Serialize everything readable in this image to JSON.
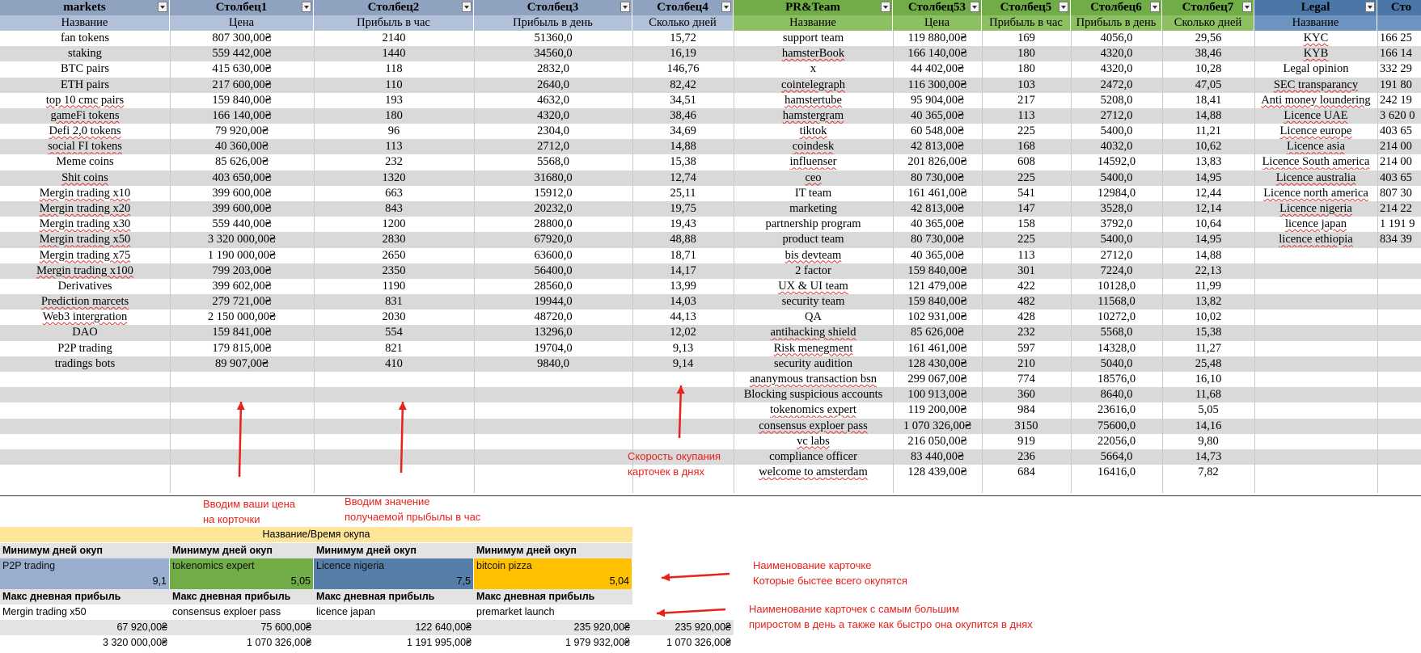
{
  "colors": {
    "header_blue": "#8fa3c1",
    "subheader_blue": "#b2c0d8",
    "header_green": "#70ad47",
    "subheader_green": "#8cc063",
    "header_steel": "#4a76a8",
    "subheader_steel": "#6d93bf",
    "stripe": "#d9d9d9",
    "yellow_band": "#fde59a",
    "summary_gray": "#e3e3e3",
    "steel_cell": "#557ea8",
    "gold_cell": "#ffc000",
    "annotation_red": "#e8211b"
  },
  "markets": {
    "headers": [
      "markets",
      "Столбец1",
      "Столбец2",
      "Столбец3",
      "Столбец4"
    ],
    "subheaders": [
      "Название",
      "Цена",
      "Прибыль в час",
      "Прибыль в день",
      "Сколько дней"
    ],
    "rows": [
      [
        "fan tokens",
        "807 300,00₴",
        "2140",
        "51360,0",
        "15,72"
      ],
      [
        "staking",
        "559 442,00₴",
        "1440",
        "34560,0",
        "16,19"
      ],
      [
        "BTC pairs",
        "415 630,00₴",
        "118",
        "2832,0",
        "146,76"
      ],
      [
        "ETH pairs",
        "217 600,00₴",
        "110",
        "2640,0",
        "82,42"
      ],
      [
        "top 10 cmc pairs",
        "159 840,00₴",
        "193",
        "4632,0",
        "34,51"
      ],
      [
        "gameFi tokens",
        "166 140,00₴",
        "180",
        "4320,0",
        "38,46"
      ],
      [
        "Defi 2,0 tokens",
        "79 920,00₴",
        "96",
        "2304,0",
        "34,69"
      ],
      [
        "social FI tokens",
        "40 360,00₴",
        "113",
        "2712,0",
        "14,88"
      ],
      [
        "Meme coins",
        "85 626,00₴",
        "232",
        "5568,0",
        "15,38"
      ],
      [
        "Shit coins",
        "403 650,00₴",
        "1320",
        "31680,0",
        "12,74"
      ],
      [
        "Mergin trading x10",
        "399 600,00₴",
        "663",
        "15912,0",
        "25,11"
      ],
      [
        "Mergin trading x20",
        "399 600,00₴",
        "843",
        "20232,0",
        "19,75"
      ],
      [
        "Mergin trading x30",
        "559 440,00₴",
        "1200",
        "28800,0",
        "19,43"
      ],
      [
        "Mergin trading x50",
        "3 320 000,00₴",
        "2830",
        "67920,0",
        "48,88"
      ],
      [
        "Mergin trading x75",
        "1 190 000,00₴",
        "2650",
        "63600,0",
        "18,71"
      ],
      [
        "Mergin trading x100",
        "799 203,00₴",
        "2350",
        "56400,0",
        "14,17"
      ],
      [
        "Derivatives",
        "399 602,00₴",
        "1190",
        "28560,0",
        "13,99"
      ],
      [
        "Prediction marcets",
        "279 721,00₴",
        "831",
        "19944,0",
        "14,03"
      ],
      [
        "Web3 intergration",
        "2 150 000,00₴",
        "2030",
        "48720,0",
        "44,13"
      ],
      [
        "DAO",
        "159 841,00₴",
        "554",
        "13296,0",
        "12,02"
      ],
      [
        "P2P trading",
        "179 815,00₴",
        "821",
        "19704,0",
        "9,13"
      ],
      [
        "tradings bots",
        "89 907,00₴",
        "410",
        "9840,0",
        "9,14"
      ]
    ]
  },
  "prteam": {
    "headers": [
      "PR&Team",
      "Столбец53",
      "Столбец5",
      "Столбец6",
      "Столбец7"
    ],
    "subheaders": [
      "Название",
      "Цена",
      "Прибыль в час",
      "Прибыль в день",
      "Сколько дней"
    ],
    "rows": [
      [
        "support team",
        "119 880,00₴",
        "169",
        "4056,0",
        "29,56"
      ],
      [
        "hamsterBook",
        "166 140,00₴",
        "180",
        "4320,0",
        "38,46"
      ],
      [
        "x",
        "44 402,00₴",
        "180",
        "4320,0",
        "10,28"
      ],
      [
        "cointelegraph",
        "116 300,00₴",
        "103",
        "2472,0",
        "47,05"
      ],
      [
        "hamstertube",
        "95 904,00₴",
        "217",
        "5208,0",
        "18,41"
      ],
      [
        "hamstergram",
        "40 365,00₴",
        "113",
        "2712,0",
        "14,88"
      ],
      [
        "tiktok",
        "60 548,00₴",
        "225",
        "5400,0",
        "11,21"
      ],
      [
        "coindesk",
        "42 813,00₴",
        "168",
        "4032,0",
        "10,62"
      ],
      [
        "influenser",
        "201 826,00₴",
        "608",
        "14592,0",
        "13,83"
      ],
      [
        "ceo",
        "80 730,00₴",
        "225",
        "5400,0",
        "14,95"
      ],
      [
        "IT team",
        "161 461,00₴",
        "541",
        "12984,0",
        "12,44"
      ],
      [
        "marketing",
        "42 813,00₴",
        "147",
        "3528,0",
        "12,14"
      ],
      [
        "partnership program",
        "40 365,00₴",
        "158",
        "3792,0",
        "10,64"
      ],
      [
        "product team",
        "80 730,00₴",
        "225",
        "5400,0",
        "14,95"
      ],
      [
        "bis devteam",
        "40 365,00₴",
        "113",
        "2712,0",
        "14,88"
      ],
      [
        "2 factor",
        "159 840,00₴",
        "301",
        "7224,0",
        "22,13"
      ],
      [
        "UX & UI team",
        "121 479,00₴",
        "422",
        "10128,0",
        "11,99"
      ],
      [
        "security team",
        "159 840,00₴",
        "482",
        "11568,0",
        "13,82"
      ],
      [
        "QA",
        "102 931,00₴",
        "428",
        "10272,0",
        "10,02"
      ],
      [
        "antihacking shield",
        "85 626,00₴",
        "232",
        "5568,0",
        "15,38"
      ],
      [
        "Risk menegment",
        "161 461,00₴",
        "597",
        "14328,0",
        "11,27"
      ],
      [
        "security audition",
        "128 430,00₴",
        "210",
        "5040,0",
        "25,48"
      ],
      [
        "ananymous transaction bsn",
        "299 067,00₴",
        "774",
        "18576,0",
        "16,10"
      ],
      [
        "Blocking suspicious accounts",
        "100 913,00₴",
        "360",
        "8640,0",
        "11,68"
      ],
      [
        "tokenomics expert",
        "119 200,00₴",
        "984",
        "23616,0",
        "5,05"
      ],
      [
        "consensus exploer pass",
        "1 070 326,00₴",
        "3150",
        "75600,0",
        "14,16"
      ],
      [
        "vc labs",
        "216 050,00₴",
        "919",
        "22056,0",
        "9,80"
      ],
      [
        "compliance officer",
        "83 440,00₴",
        "236",
        "5664,0",
        "14,73"
      ],
      [
        "welcome to amsterdam",
        "128 439,00₴",
        "684",
        "16416,0",
        "7,82"
      ]
    ]
  },
  "legal": {
    "headers": [
      "Legal",
      "Сто"
    ],
    "subheaders": [
      "Название",
      ""
    ],
    "rows": [
      [
        "KYC",
        "166 25"
      ],
      [
        "KYB",
        "166 14"
      ],
      [
        "Legal opinion",
        "332 29"
      ],
      [
        "SEC transparancy",
        "191 80"
      ],
      [
        "Anti money loundering",
        "242 19"
      ],
      [
        "Licence UAE",
        "3 620 0"
      ],
      [
        "Licence europe",
        "403 65"
      ],
      [
        "Licence asia",
        "214 00"
      ],
      [
        "Licence South america",
        "214 00"
      ],
      [
        "Licence australia",
        "403 65"
      ],
      [
        "Licence north america",
        "807 30"
      ],
      [
        "Licence nigeria",
        "214 22"
      ],
      [
        "licence japan",
        "1 191 9"
      ],
      [
        "licence ethiopia",
        "834 39"
      ]
    ]
  },
  "annotations": {
    "price_note": [
      "Вводим ваши цена",
      "на корточки"
    ],
    "profit_note": [
      "Вводим значение",
      "получаемой прыбылы в час"
    ],
    "payback_note": [
      "Скорость окупания",
      "карточек в днях"
    ],
    "fastest_note": [
      "Наименование карточке",
      "Которые быстее всего окупятся"
    ],
    "maxprofit_note": [
      "Наименование карточек с самым большим",
      "приростом в день а также как быстро она окупится в днях"
    ]
  },
  "summary": {
    "band_title": "Название/Время окупа",
    "min_label": "Минимум дней окуп",
    "min_cards": [
      {
        "name": "P2P trading",
        "days": "9,1"
      },
      {
        "name": "tokenomics expert",
        "days": "5,05"
      },
      {
        "name": "Licence nigeria",
        "days": "7,5"
      },
      {
        "name": "bitcoin pizza",
        "days": "5,04"
      }
    ],
    "max_label": "Макс дневная прибыль",
    "max_cards": [
      {
        "name": "Mergin trading x50",
        "profit": "67 920,00₴",
        "price": "3 320 000,00₴"
      },
      {
        "name": "consensus exploer pass",
        "profit": "75 600,00₴",
        "price": "1 070 326,00₴"
      },
      {
        "name": "licence japan",
        "profit": "122 640,00₴",
        "price": "1 191 995,00₴"
      },
      {
        "name": "premarket launch",
        "profit": "235 920,00₴",
        "price": "1 979 932,00₴"
      }
    ],
    "max_overall_profit": "235 920,00₴",
    "max_overall_price": "1 070 326,00₴"
  }
}
